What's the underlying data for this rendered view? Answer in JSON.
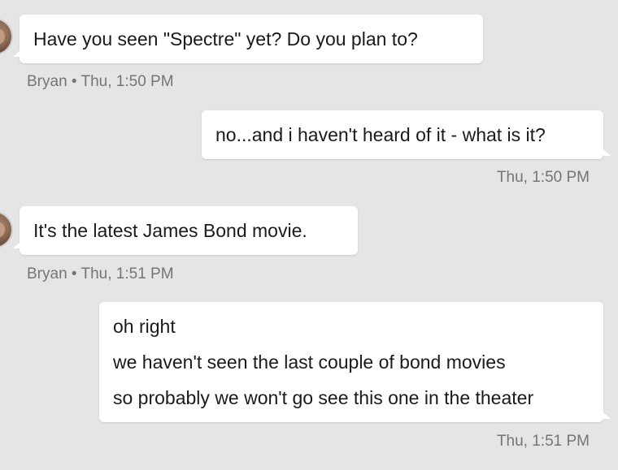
{
  "messages": [
    {
      "direction": "incoming",
      "text_lines": [
        "Have you seen \"Spectre\" yet? Do you plan to?"
      ],
      "meta": "Bryan • Thu, 1:50 PM"
    },
    {
      "direction": "outgoing",
      "text_lines": [
        "no...and i haven't heard of it - what is it?"
      ],
      "meta": "Thu, 1:50 PM"
    },
    {
      "direction": "incoming",
      "text_lines": [
        "It's the latest James Bond movie."
      ],
      "meta": "Bryan • Thu, 1:51 PM"
    },
    {
      "direction": "outgoing",
      "text_lines": [
        "oh right",
        "we haven't seen the last couple of bond movies",
        "so probably we won't go see this one in the theater"
      ],
      "meta": "Thu, 1:51 PM"
    }
  ],
  "colors": {
    "background": "#e5e5e5",
    "bubble": "#ffffff",
    "text": "#1a1a1a",
    "meta": "#757575"
  },
  "icons": {
    "avatar": "avatar-photo-icon"
  }
}
